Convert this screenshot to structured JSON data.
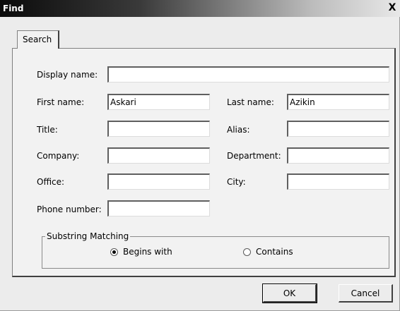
{
  "window": {
    "title": "Find",
    "close_label": "X"
  },
  "tabs": [
    {
      "label": "Search"
    }
  ],
  "fields": {
    "display_name": {
      "label": "Display name:",
      "value": ""
    },
    "first_name": {
      "label": "First name:",
      "value": "Askari"
    },
    "last_name": {
      "label": "Last name:",
      "value": "Azikin"
    },
    "title": {
      "label": "Title:",
      "value": ""
    },
    "alias": {
      "label": "Alias:",
      "value": ""
    },
    "company": {
      "label": "Company:",
      "value": ""
    },
    "department": {
      "label": "Department:",
      "value": ""
    },
    "office": {
      "label": "Office:",
      "value": ""
    },
    "city": {
      "label": "City:",
      "value": ""
    },
    "phone_number": {
      "label": "Phone number:",
      "value": ""
    }
  },
  "substring_matching": {
    "legend": "Substring Matching",
    "options": [
      {
        "label": "Begins with",
        "checked": true
      },
      {
        "label": "Contains",
        "checked": false
      }
    ]
  },
  "buttons": {
    "ok": "OK",
    "cancel": "Cancel"
  }
}
